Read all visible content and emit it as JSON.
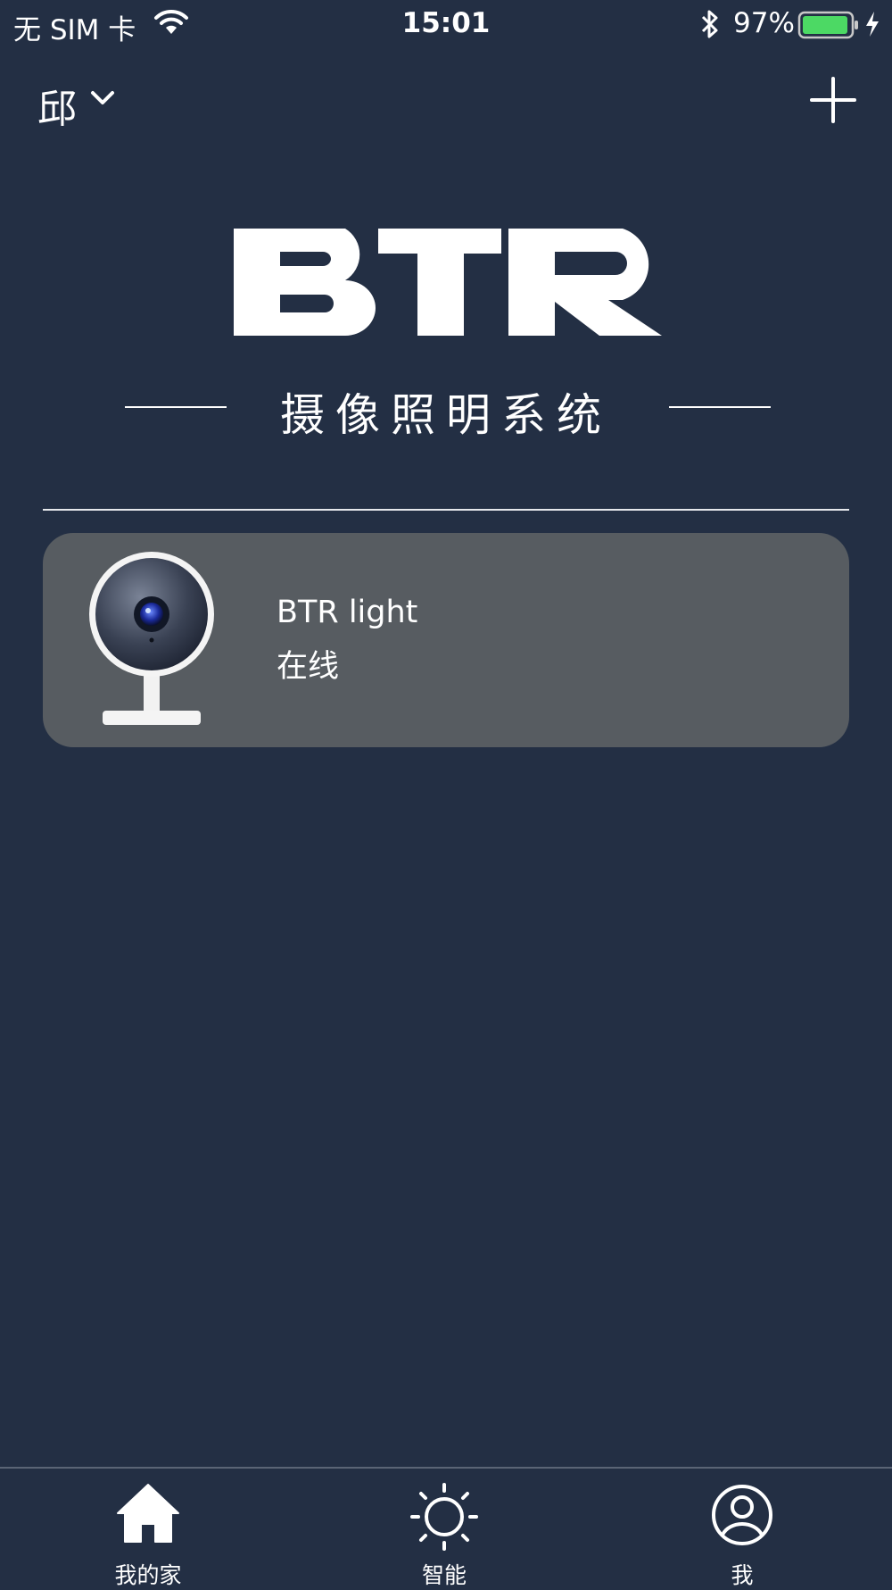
{
  "status_bar": {
    "carrier": "无 SIM 卡",
    "time": "15:01",
    "battery_percent": "97%",
    "battery_level": 0.97,
    "battery_color": "#4cd964",
    "icons": [
      "wifi-icon",
      "bluetooth-icon",
      "battery-icon",
      "charging-bolt-icon"
    ]
  },
  "header": {
    "home_name": "邱",
    "dropdown_icon": "chevron-down-icon",
    "add_icon": "plus-icon"
  },
  "brand": {
    "logo_text": "BTR",
    "tagline": "摄像照明系统"
  },
  "devices": [
    {
      "name": "BTR light",
      "status": "在线",
      "icon": "camera-device-image"
    }
  ],
  "tab_bar": {
    "tabs": [
      {
        "label": "我的家",
        "icon": "home-icon",
        "active": true
      },
      {
        "label": "智能",
        "icon": "sun-icon",
        "active": false
      },
      {
        "label": "我",
        "icon": "user-icon",
        "active": false
      }
    ]
  },
  "colors": {
    "background": "#232f44",
    "card": "#575c61",
    "text": "#ffffff"
  }
}
